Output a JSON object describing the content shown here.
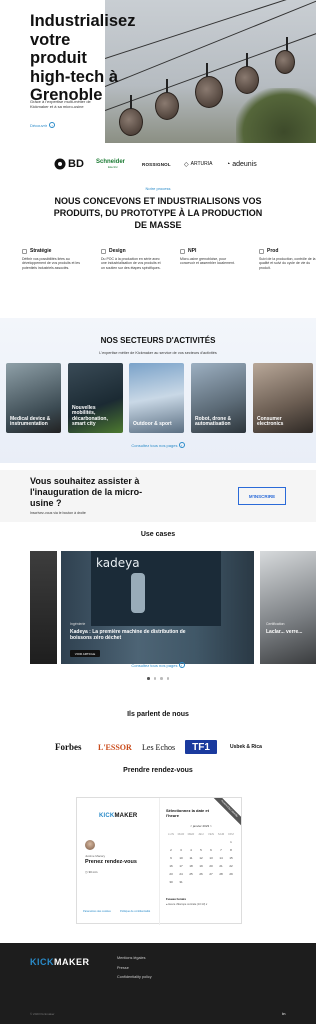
{
  "hero": {
    "title": "Industrialisez votre produit high-tech à Grenoble",
    "subtitle": "Grâce à l'expertise multi-métier de Kickmaker et à sa micro-usine",
    "link_label": "Découvrir"
  },
  "partners": [
    {
      "name": "BD",
      "icon": "bd-burst-icon"
    },
    {
      "name": "Schneider",
      "sub": "Electric"
    },
    {
      "name": "ROSSIGNOL"
    },
    {
      "name": "ARTURIA"
    },
    {
      "name": "adeunis"
    }
  ],
  "process": {
    "eyebrow": "Notre process",
    "title": "NOUS CONCEVONS ET INDUSTRIALISONS VOS PRODUITS, DU PROTOTYPE À LA PRODUCTION DE MASSE",
    "steps": [
      {
        "label": "Stratégie",
        "text": "Définir vos possibilités liées au développement de vos produits et les potentiels industriels associés."
      },
      {
        "label": "Design",
        "text": "Du POC à la production en série avec une industrialisation de vos produits et un soutien sur des étapes spécifiques."
      },
      {
        "label": "NPI",
        "text": "Micro-usine grenobloise, pour concevoir et assembler localement."
      },
      {
        "label": "Prod",
        "text": "Suivi de la production, contrôle de la qualité et suivi du cycle de vie du produit."
      }
    ]
  },
  "sectors": {
    "title": "NOS SECTEURS D'ACTIVITÉS",
    "subtitle": "L'expertise métier de Kickmaker au service de vos secteurs d'activités",
    "cards": [
      {
        "label": "Medical device & instrumentation"
      },
      {
        "label": "Nouvelles mobilités, décarbonation, smart city"
      },
      {
        "label": "Outdoor & sport"
      },
      {
        "label": "Robot, drone & automatisation"
      },
      {
        "label": "Consumer electronics"
      }
    ],
    "link_label": "Consultez tous nos pages"
  },
  "cta": {
    "title": "Vous souhaitez assister à l'inauguration de la micro-usine ?",
    "subtitle": "Inscrivez-vous via le bouton à droite",
    "button": "M'INSCRIRE"
  },
  "use_cases": {
    "title": "Use cases",
    "items": [
      {
        "tag": "Ingénierie",
        "title": "Kadeya : La première machine de distribution de boissons zéro déchet",
        "button": "VOIR ARTICLE",
        "brand": "kadeya"
      }
    ],
    "next_peek": {
      "tag": "Certification",
      "title": "Laclar... verre..."
    },
    "link_label": "Consultez tous nos pages",
    "pager": {
      "count": 4,
      "active": 0
    }
  },
  "press": {
    "title": "Ils parlent de nous",
    "logos": [
      "Forbes",
      "L'ESSOR",
      "Les Echos",
      "TF1",
      "Usbek & Rica"
    ]
  },
  "booking": {
    "title": "Prendre rendez-vous",
    "brand_k": "KICK",
    "brand_rest": "MAKER",
    "host": "Justine Macary",
    "meeting_title": "Prenez rendez-vous",
    "duration": "30 min",
    "cookie_link": "Paramètres des cookies",
    "privacy_link": "Politique de confidentialité",
    "pick_title": "Sélectionnez la date et l'heure",
    "month": "< janvier 2023 >",
    "weekdays": [
      "LUN",
      "MAR",
      "MER",
      "JEU",
      "VEN",
      "SAM",
      "DIM"
    ],
    "weeks": [
      [
        "",
        "",
        "",
        "",
        "",
        "",
        "1"
      ],
      [
        "2",
        "3",
        "4",
        "5",
        "6",
        "7",
        "8"
      ],
      [
        "9",
        "10",
        "11",
        "12",
        "13",
        "14",
        "15"
      ],
      [
        "16",
        "17",
        "18",
        "19",
        "20",
        "21",
        "22"
      ],
      [
        "23",
        "24",
        "25",
        "26",
        "27",
        "28",
        "29"
      ],
      [
        "30",
        "31",
        "",
        "",
        "",
        "",
        ""
      ]
    ],
    "tz_label": "Fuseau horaire",
    "tz_value": "● Heure d'Europe centrale (10:13) ▾",
    "ribbon": "Powered by Calendly"
  },
  "footer": {
    "brand_k": "KICK",
    "brand_rest": "MAKER",
    "links": [
      "Mentions légales",
      "Presse",
      "Confidentiality policy"
    ],
    "copyright": "© 2023 Kickmaker",
    "social": "in"
  },
  "colors": {
    "accent": "#2a8bc9",
    "cta_border": "#2a6ad8",
    "footer_bg": "#1d1d1d"
  }
}
